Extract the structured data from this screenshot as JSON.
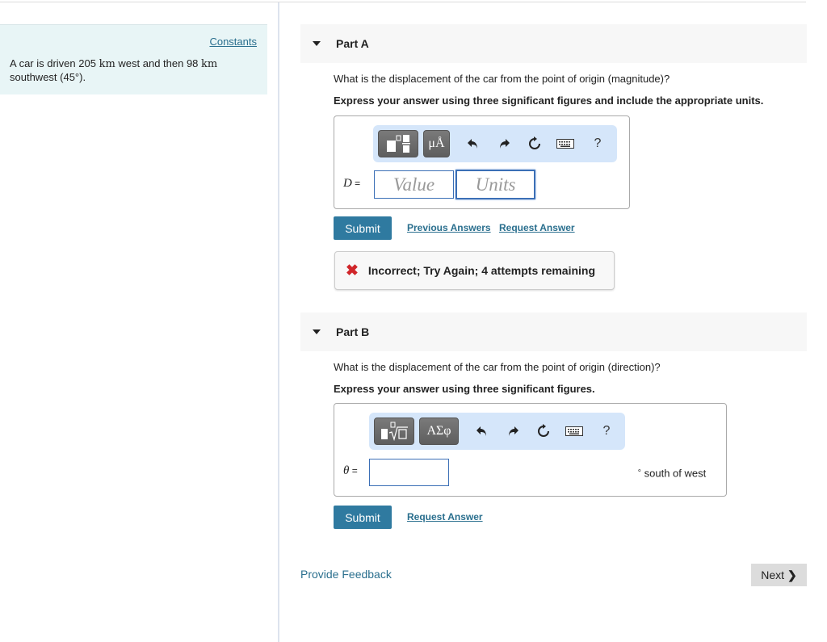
{
  "intro": {
    "constants_link": "Constants",
    "problem_prefix": "A car is driven 205 ",
    "problem_unit1": "km",
    "problem_mid": " west and then 98 ",
    "problem_unit2": "km",
    "problem_suffix": "southwest (45°)."
  },
  "part_a": {
    "title": "Part A",
    "question": "What is the displacement of the car from the point of origin (magnitude)?",
    "instruction": "Express your answer using three significant figures and include the appropriate units.",
    "toolbar": {
      "template_icon": "fraction-template-icon",
      "units_button": "μÅ",
      "undo_icon": "undo-icon",
      "redo_icon": "redo-icon",
      "reset_icon": "reset-icon",
      "keyboard_icon": "keyboard-icon",
      "help": "?"
    },
    "variable": "D",
    "equals": " =",
    "value_placeholder": "Value",
    "units_placeholder": "Units",
    "submit": "Submit",
    "previous_answers": "Previous Answers",
    "request_answer": "Request Answer",
    "feedback": {
      "icon": "✖",
      "message": "Incorrect; Try Again; 4 attempts remaining",
      "color": "#d0262a"
    }
  },
  "part_b": {
    "title": "Part B",
    "question": "What is the displacement of the car from the point of origin (direction)?",
    "instruction": "Express your answer using three significant figures.",
    "toolbar": {
      "template_icon": "radical-template-icon",
      "symbols_button": "ΑΣφ",
      "undo_icon": "undo-icon",
      "redo_icon": "redo-icon",
      "reset_icon": "reset-icon",
      "keyboard_icon": "keyboard-icon",
      "help": "?"
    },
    "variable": "θ",
    "equals": " =",
    "value": "",
    "degree": "∘",
    "suffix": "south of west",
    "submit": "Submit",
    "request_answer": "Request Answer"
  },
  "footer": {
    "provide_feedback": "Provide Feedback",
    "next": "Next",
    "next_chevron": "❯"
  },
  "colors": {
    "accent": "#2f7aa0",
    "link": "#2a6f8e",
    "intro_bg": "#e8f5f6",
    "toolbar_bg": "#d5e6fa",
    "error": "#d0262a"
  }
}
